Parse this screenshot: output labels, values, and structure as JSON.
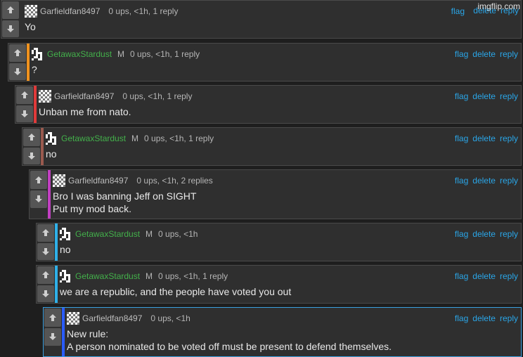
{
  "watermark": "imgflip.com",
  "actions": {
    "flag": "flag",
    "delete": "delete",
    "reply": "reply"
  },
  "colors": {
    "background": "#1e1e1e",
    "panel": "#2f2f2f",
    "link": "#2aa6e8",
    "username_green": "#43b14b",
    "username_gray": "#bdbdbd"
  },
  "comments": [
    {
      "username": "Garfieldfan8497",
      "mod": "",
      "stats": "0 ups, <1h, 1 reply",
      "lines": [
        "Yo"
      ],
      "thread_color": "#2f2f2f"
    },
    {
      "username": "GetawaxStardust",
      "mod": "M",
      "stats": "0 ups, <1h, 1 reply",
      "lines": [
        "?"
      ],
      "thread_color": "#f0921e"
    },
    {
      "username": "Garfieldfan8497",
      "mod": "",
      "stats": "0 ups, <1h, 1 reply",
      "lines": [
        "Unban me from nato."
      ],
      "thread_color": "#e03a3a"
    },
    {
      "username": "GetawaxStardust",
      "mod": "M",
      "stats": "0 ups, <1h, 1 reply",
      "lines": [
        "no"
      ],
      "thread_color": "#9a5a4e"
    },
    {
      "username": "Garfieldfan8497",
      "mod": "",
      "stats": "0 ups, <1h, 2 replies",
      "lines": [
        "Bro I was banning Jeff on SIGHT",
        "Put my mod back."
      ],
      "thread_color": "#c13fc1"
    },
    {
      "username": "GetawaxStardust",
      "mod": "M",
      "stats": "0 ups, <1h",
      "lines": [
        "no"
      ],
      "thread_color": "#2fb0e8"
    },
    {
      "username": "GetawaxStardust",
      "mod": "M",
      "stats": "0 ups, <1h, 1 reply",
      "lines": [
        "we are a republic, and the people have voted you out"
      ],
      "thread_color": "#2fb0e8"
    },
    {
      "username": "Garfieldfan8497",
      "mod": "",
      "stats": "0 ups, <1h",
      "lines": [
        "New rule:",
        "A person nominated to be voted off must be present to defend themselves."
      ],
      "thread_color": "#2a5cff"
    }
  ]
}
